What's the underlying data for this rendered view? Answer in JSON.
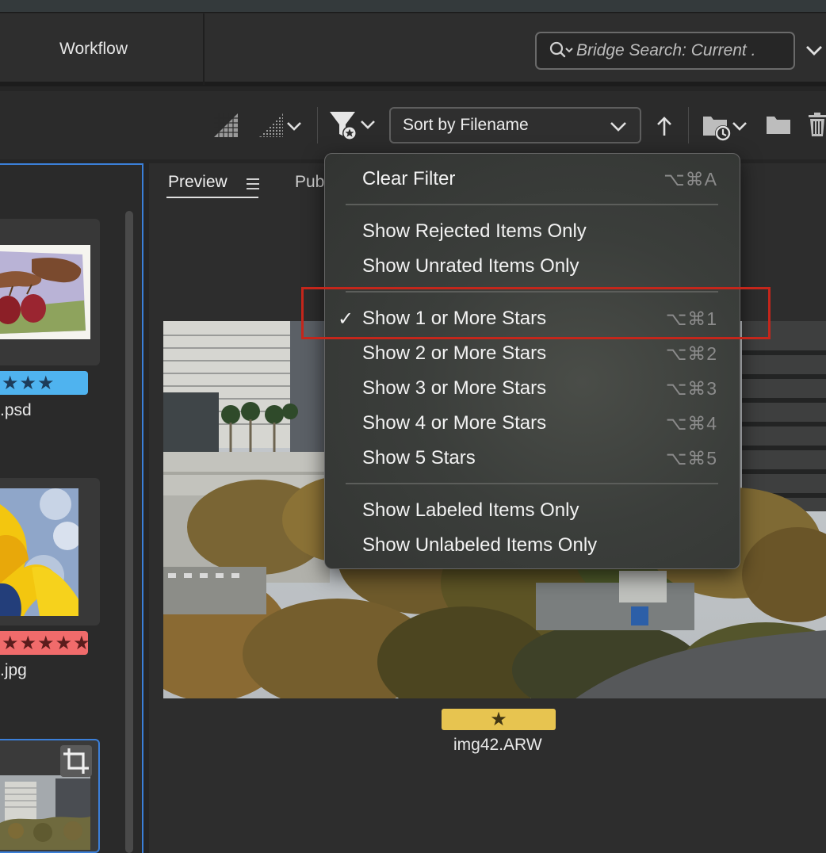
{
  "header": {
    "workflow_label": "Workflow",
    "search_placeholder": "Bridge Search: Current ."
  },
  "toolbar": {
    "sort_label": "Sort by Filename",
    "icons": [
      "quality-icon",
      "quality-options-icon",
      "filter-icon",
      "sort-ascending-icon",
      "recent-folders-icon",
      "new-folder-icon",
      "trash-icon"
    ]
  },
  "preview_panel": {
    "tab_preview": "Preview",
    "tab_publish": "Pub"
  },
  "thumbnails": [
    {
      "name_suffix": ".psd",
      "rating_stars": "★★★",
      "label_color": "#4fb3ef"
    },
    {
      "name_suffix": ".jpg",
      "rating_stars": "★★★★★",
      "label_color": "#f06b6b"
    },
    {
      "name_suffix": "",
      "rating_stars": "",
      "label_color": ""
    }
  ],
  "preview_item": {
    "filename": "img42.ARW",
    "rating_star": "★",
    "label_color": "#e7c450"
  },
  "filter_menu": {
    "items": [
      {
        "label": "Clear Filter",
        "shortcut": "⌥⌘A",
        "checked": false
      },
      {
        "label": "Show Rejected Items Only",
        "shortcut": "",
        "checked": false
      },
      {
        "label": "Show Unrated Items Only",
        "shortcut": "",
        "checked": false
      },
      {
        "label": "Show 1 or More Stars",
        "shortcut": "⌥⌘1",
        "checked": true,
        "check_mark": "✓"
      },
      {
        "label": "Show 2 or More Stars",
        "shortcut": "⌥⌘2",
        "checked": false
      },
      {
        "label": "Show 3 or More Stars",
        "shortcut": "⌥⌘3",
        "checked": false
      },
      {
        "label": "Show 4 or More Stars",
        "shortcut": "⌥⌘4",
        "checked": false
      },
      {
        "label": "Show 5 Stars",
        "shortcut": "⌥⌘5",
        "checked": false
      },
      {
        "label": "Show Labeled Items Only",
        "shortcut": "",
        "checked": false
      },
      {
        "label": "Show Unlabeled Items Only",
        "shortcut": "",
        "checked": false
      }
    ]
  },
  "colors": {
    "selection_border": "#3b7fd8",
    "highlight_annotation": "#c4261b"
  }
}
